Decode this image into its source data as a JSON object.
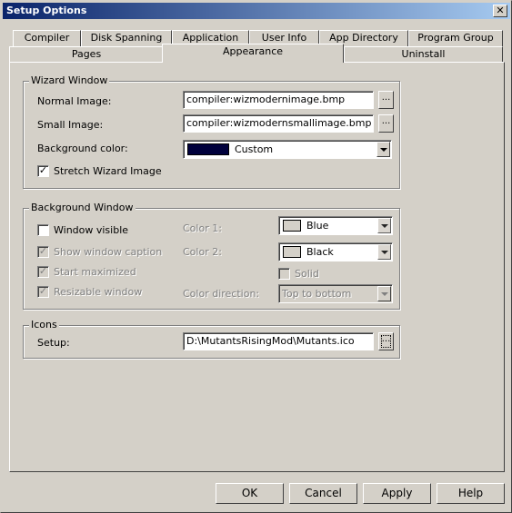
{
  "window": {
    "title": "Setup Options",
    "close_glyph": "✕"
  },
  "tabs_back": [
    "Compiler",
    "Disk Spanning",
    "Application",
    "User Info",
    "App Directory",
    "Program Group"
  ],
  "tabs_front": [
    "Pages",
    "Appearance",
    "Uninstall"
  ],
  "active_tab": "Appearance",
  "wizard": {
    "title": "Wizard Window",
    "normal_label": "Normal Image:",
    "normal_value": "compiler:wizmodernimage.bmp",
    "small_label": "Small Image:",
    "small_value": "compiler:wizmodernsmallimage.bmp",
    "browse": "...",
    "bg_label": "Background color:",
    "bg_value": "Custom",
    "bg_swatch": "#00003c",
    "stretch_label": "Stretch Wizard Image",
    "stretch_checked": true
  },
  "background": {
    "title": "Background Window",
    "visible_label": "Window visible",
    "visible_checked": false,
    "caption_label": "Show window caption",
    "caption_checked": true,
    "max_label": "Start maximized",
    "max_checked": true,
    "resize_label": "Resizable window",
    "resize_checked": true,
    "color1_label": "Color 1:",
    "color1_value": "Blue",
    "color2_label": "Color 2:",
    "color2_value": "Black",
    "solid_label": "Solid",
    "solid_checked": false,
    "direction_label": "Color direction:",
    "direction_value": "Top to bottom"
  },
  "icons": {
    "title": "Icons",
    "setup_label": "Setup:",
    "setup_value": "D:\\MutantsRisingMod\\Mutants.ico",
    "browse": "..."
  },
  "buttons": {
    "ok": "OK",
    "cancel": "Cancel",
    "apply": "Apply",
    "help": "Help"
  },
  "colors": {
    "swatch_neutral": "#d4d0c8"
  }
}
